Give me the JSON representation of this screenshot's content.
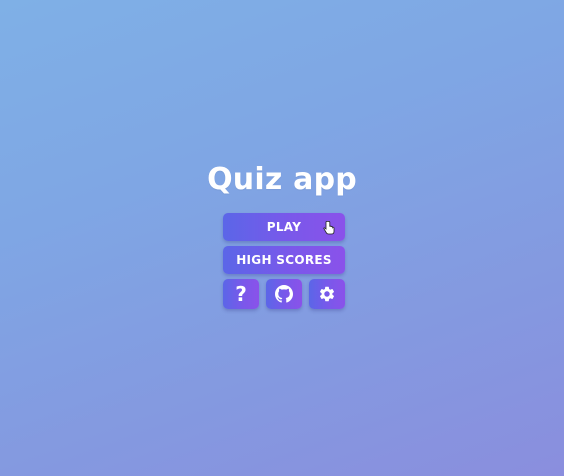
{
  "app": {
    "title": "Quiz app"
  },
  "menu": {
    "play_label": "PLAY",
    "high_scores_label": "HIGH SCORES",
    "icon_buttons": [
      {
        "name": "help",
        "icon": "question-icon",
        "glyph": "?"
      },
      {
        "name": "github",
        "icon": "github-icon"
      },
      {
        "name": "settings",
        "icon": "gear-icon"
      }
    ]
  },
  "colors": {
    "background_start": "#7fb0e6",
    "background_end": "#8a8ede",
    "button_start": "#5b66e8",
    "button_end": "#8a52ea",
    "text": "#ffffff"
  }
}
